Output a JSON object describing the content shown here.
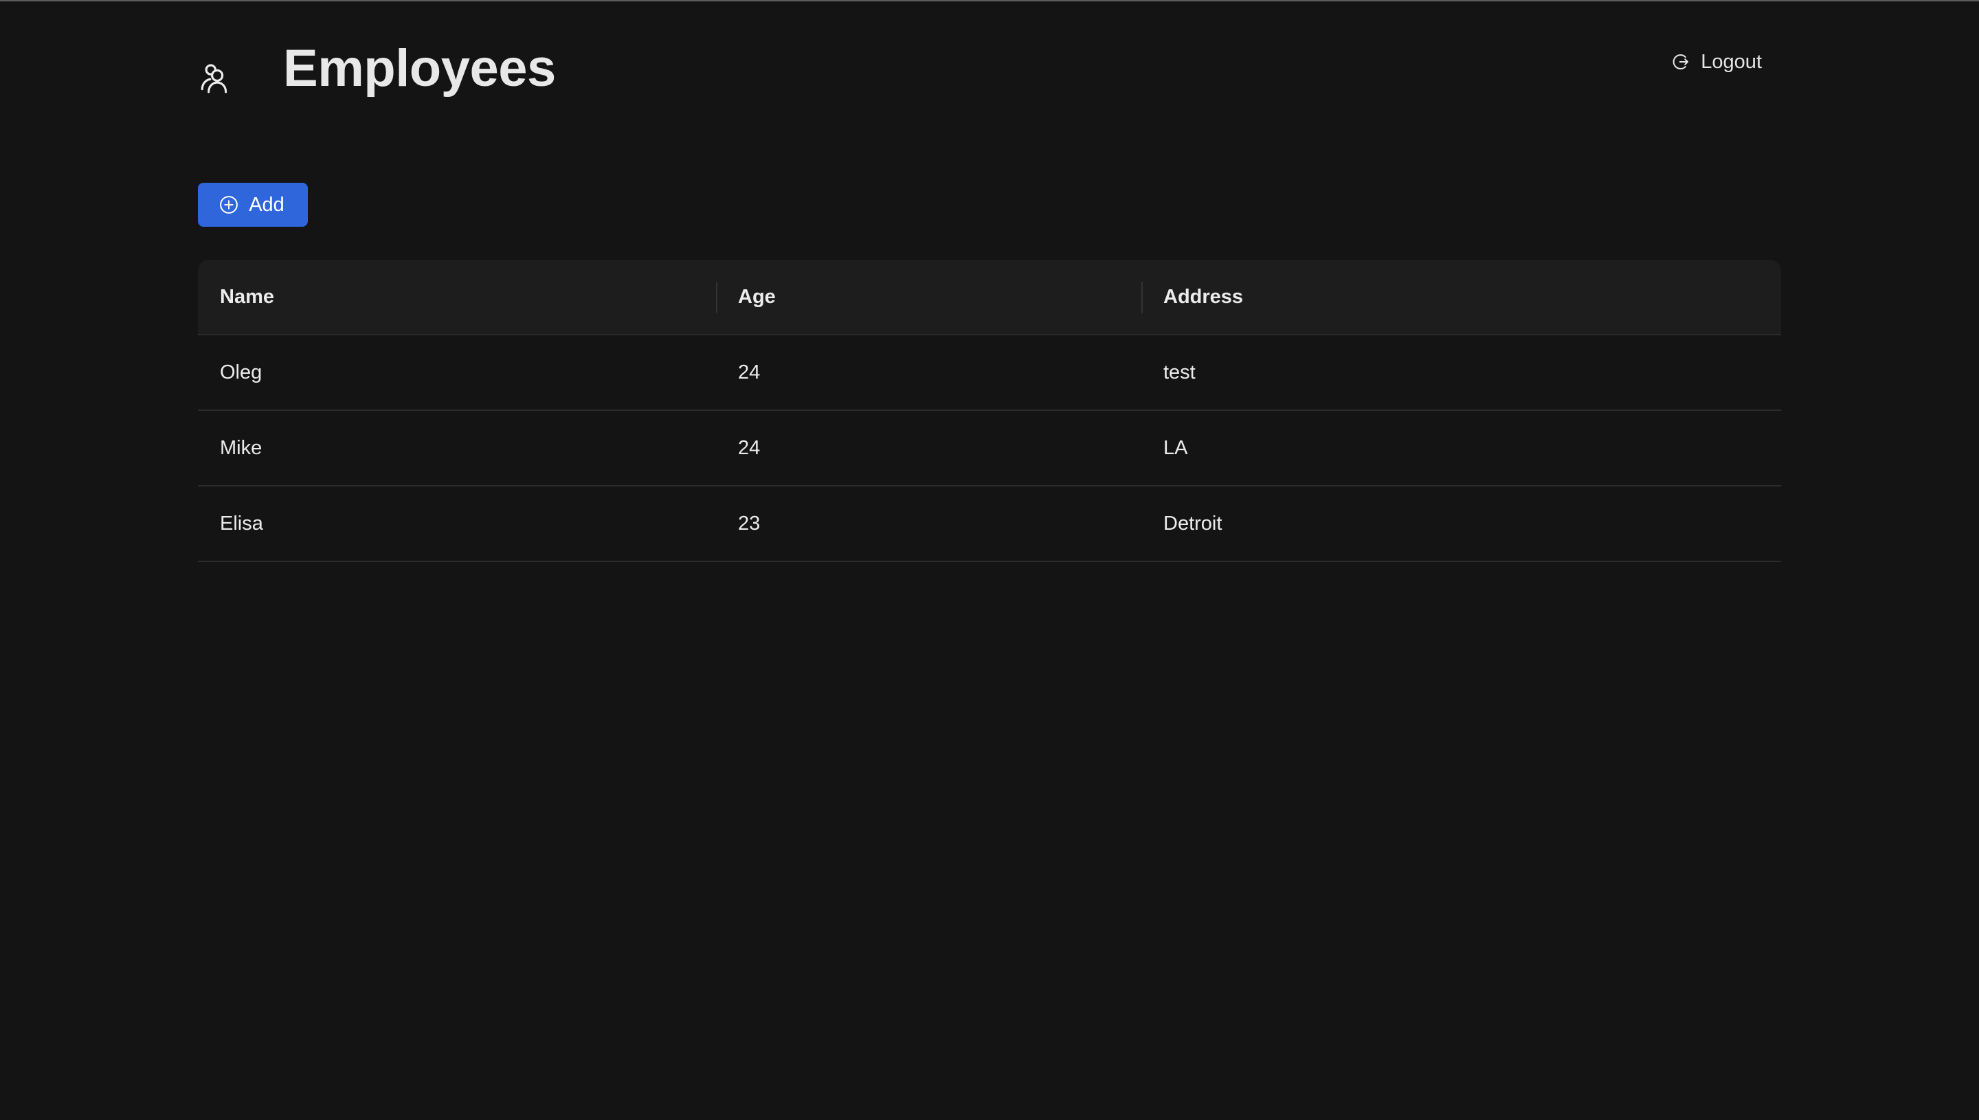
{
  "header": {
    "title": "Employees",
    "brand_icon": "team-icon",
    "logout_label": "Logout",
    "logout_icon": "logout-icon"
  },
  "toolbar": {
    "add_label": "Add",
    "add_icon": "plus-circle-icon",
    "add_color": "#2f66dc"
  },
  "table": {
    "columns": [
      "Name",
      "Age",
      "Address"
    ],
    "rows": [
      [
        "Oleg",
        "24",
        "test"
      ],
      [
        "Mike",
        "24",
        "LA"
      ],
      [
        "Elisa",
        "23",
        "Detroit"
      ]
    ]
  },
  "theme": {
    "background": "#141414",
    "header_row_bg": "#1d1d1d",
    "text": "#ececec"
  }
}
